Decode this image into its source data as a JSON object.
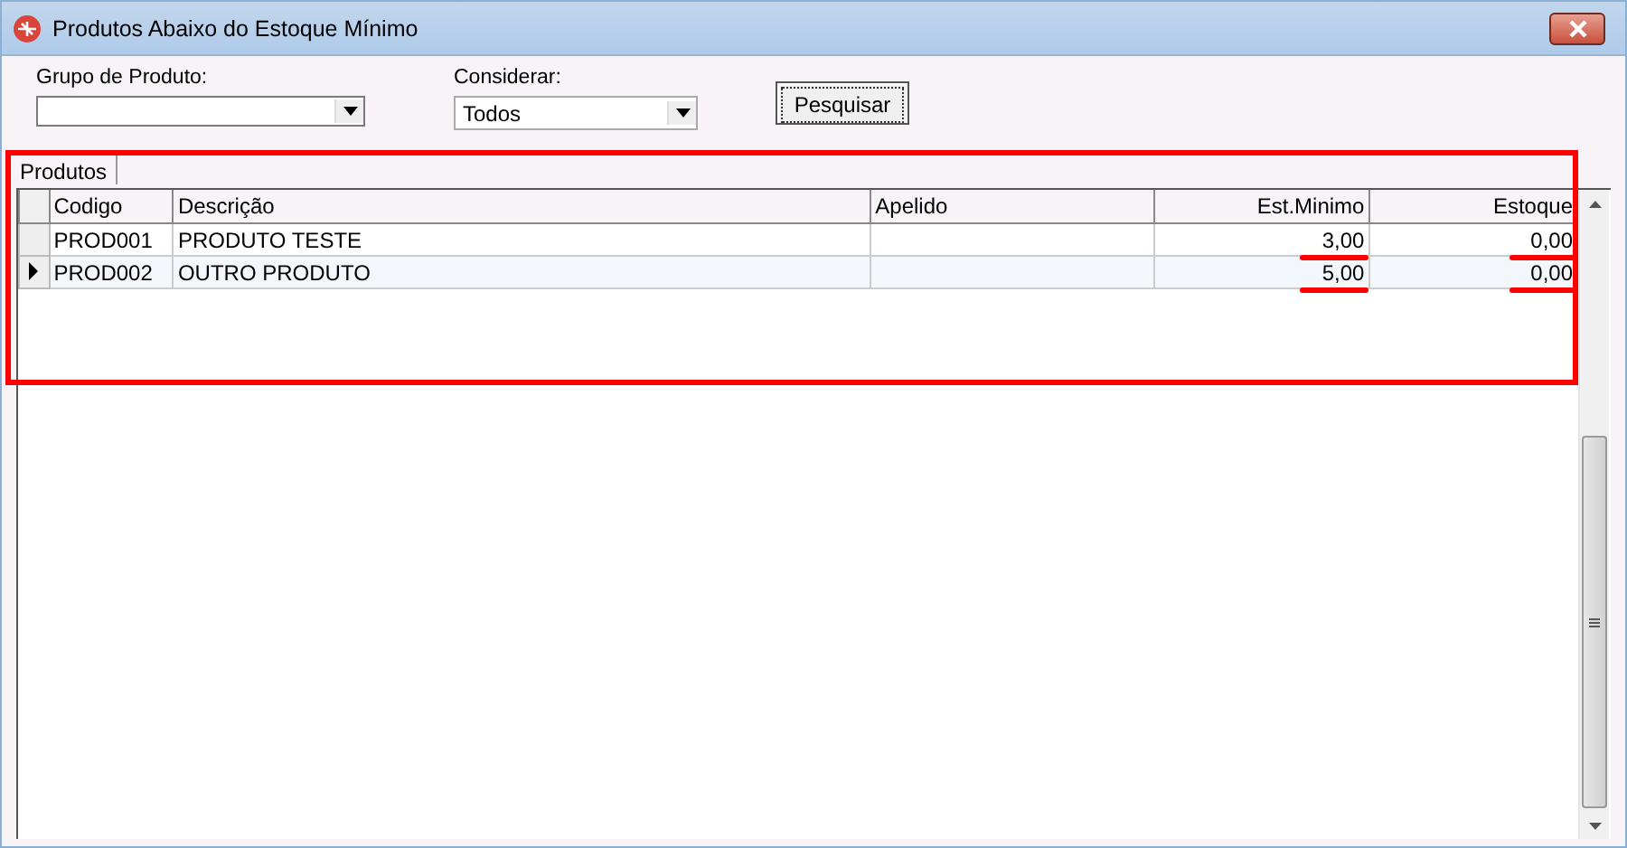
{
  "window": {
    "title": "Produtos Abaixo do Estoque Mínimo"
  },
  "filters": [
    {
      "label": "Grupo de Produto:",
      "kind": "combo"
    },
    {
      "label": "Considerar:",
      "kind": "combo",
      "value": "Todos"
    }
  ],
  "search_button": "Pesquisar",
  "tabs": [
    {
      "label": "Produtos",
      "selected": true
    }
  ],
  "table": {
    "columns": [
      {
        "label": "Codigo",
        "kind": "text"
      },
      {
        "label": "Descrição",
        "kind": "text"
      },
      {
        "label": "Apelido",
        "kind": "text"
      },
      {
        "label": "Est.Minimo",
        "kind": "number"
      },
      {
        "label": "Estoque",
        "kind": "number"
      }
    ],
    "rows": [
      {
        "selected": false,
        "underlined": true,
        "cells": [
          "PROD001",
          "PRODUTO TESTE",
          "",
          "3,00",
          "0,00"
        ]
      },
      {
        "selected": true,
        "underlined": true,
        "cells": [
          "PROD002",
          "OUTRO PRODUTO",
          "",
          "5,00",
          "0,00"
        ]
      }
    ]
  },
  "annotations": [
    {
      "kind": "box"
    }
  ]
}
